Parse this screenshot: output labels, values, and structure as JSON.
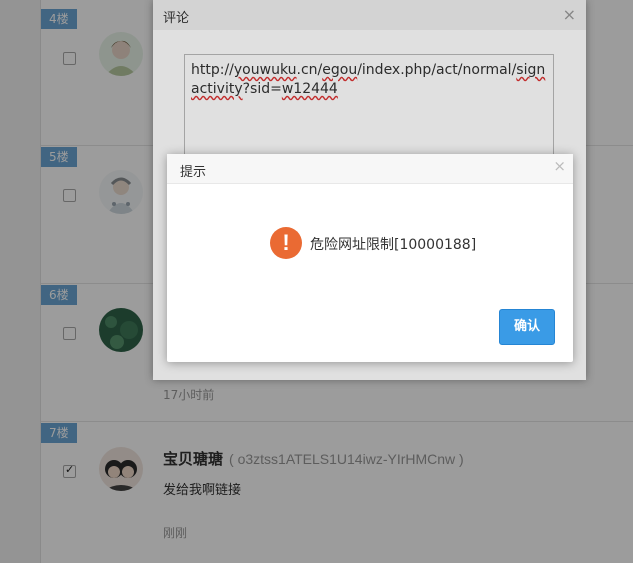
{
  "floors": [
    {
      "tag": "4楼",
      "checked": false,
      "avatar_colors": [
        "#e8f4e9",
        "#b8c9a1"
      ]
    },
    {
      "tag": "5楼",
      "checked": false,
      "avatar_colors": [
        "#ffffff",
        "#9aa7b0"
      ]
    },
    {
      "tag": "6楼",
      "checked": false,
      "avatar_colors": [
        "#3f7a5a",
        "#1e4233"
      ]
    },
    {
      "tag": "7楼",
      "checked": true,
      "avatar_colors": [
        "#f1e6df",
        "#2b2b2b"
      ],
      "username": "宝贝瑭瑭",
      "userid": "( o3ztss1ATELS1U14iwz-YIrHMCnw )",
      "comment": "发给我啊链接",
      "time": "刚刚"
    }
  ],
  "floor6_time": "17小时前",
  "comment_dialog": {
    "title": "评论",
    "close_label": "×",
    "text_segments": [
      {
        "t": "http://",
        "spell": false
      },
      {
        "t": "youwuku",
        "spell": true
      },
      {
        "t": ".cn/",
        "spell": false
      },
      {
        "t": "egou",
        "spell": true
      },
      {
        "t": "/index.php/act/normal/",
        "spell": false
      },
      {
        "t": "signactivity",
        "spell": true
      },
      {
        "t": "?sid=",
        "spell": false
      },
      {
        "t": "w12444",
        "spell": true
      }
    ]
  },
  "alert_dialog": {
    "title": "提示",
    "close_label": "×",
    "icon_glyph": "!",
    "message": "危险网址限制[10000188]",
    "ok_label": "确认"
  },
  "colors": {
    "floor_tag": "#6aa6d6",
    "alert_icon": "#ea6a33",
    "ok_button": "#3a9be6"
  }
}
